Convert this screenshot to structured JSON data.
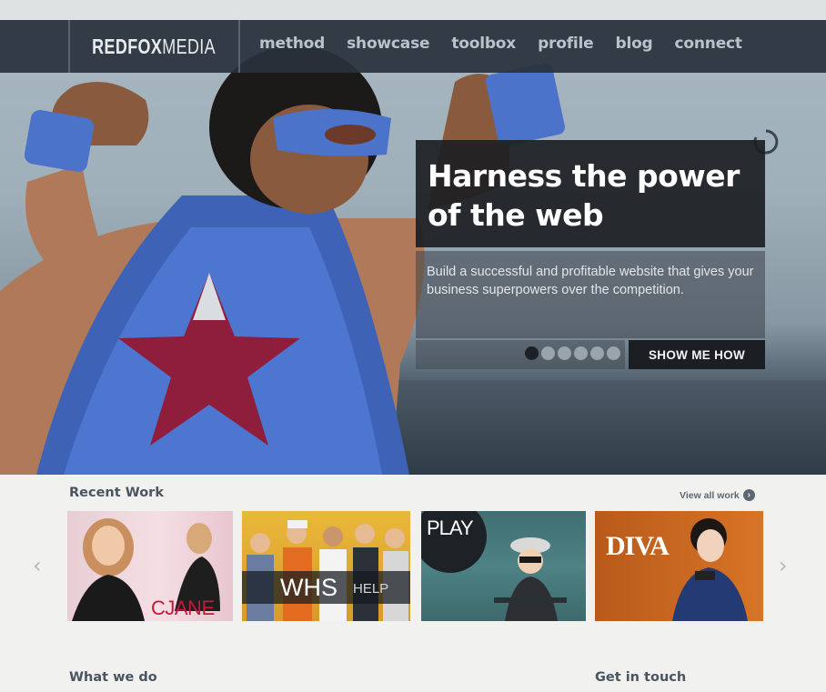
{
  "nav": {
    "logo_bold": "REDFOX",
    "logo_thin": "MEDIA",
    "items": [
      {
        "label": "method"
      },
      {
        "label": "showcase"
      },
      {
        "label": "toolbox"
      },
      {
        "label": "profile"
      },
      {
        "label": "blog"
      },
      {
        "label": "connect"
      }
    ]
  },
  "hero": {
    "headline": "Harness the power of the web",
    "body": "Build a successful and profitable website that gives your business superpowers over the competition.",
    "cta_label": "SHOW ME HOW",
    "slide_count": 6,
    "active_slide": 1
  },
  "recent_work": {
    "heading": "Recent Work",
    "view_all": "View all work",
    "prev_arrow": "‹",
    "next_arrow": "›",
    "thumbnails": [
      {
        "caption": "CJANE"
      },
      {
        "caption": "WHS",
        "caption_secondary": "HELP"
      },
      {
        "caption": "PLAY"
      },
      {
        "caption": "DIVA"
      }
    ]
  },
  "sections": {
    "what_we_do": "What we do",
    "get_in_touch": "Get in touch"
  },
  "colors": {
    "nav_bg": "#29313c",
    "cta_bg": "#1b1e22",
    "heading_text": "#4a5560"
  }
}
